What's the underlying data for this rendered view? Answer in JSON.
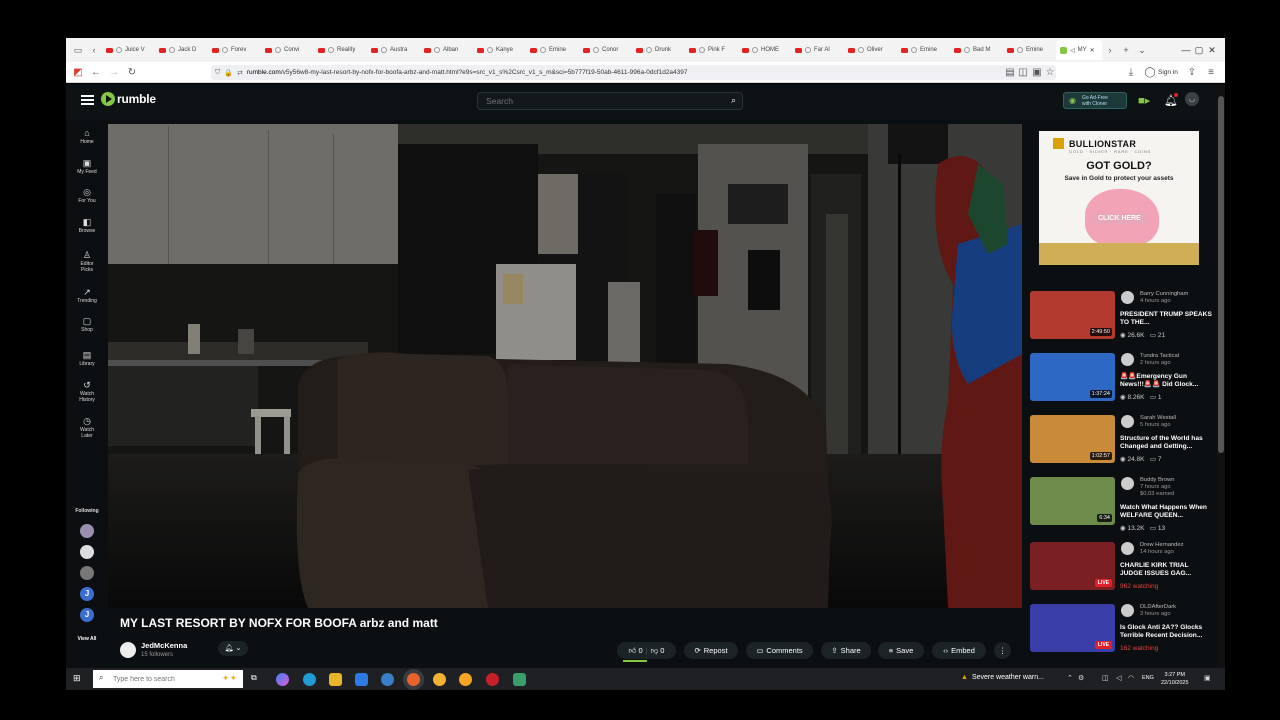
{
  "browser": {
    "tabs": [
      {
        "label": "Juice V"
      },
      {
        "label": "Jack D"
      },
      {
        "label": "Forev"
      },
      {
        "label": "Convi"
      },
      {
        "label": "Reality"
      },
      {
        "label": "Austra"
      },
      {
        "label": "Alban"
      },
      {
        "label": "Kanye"
      },
      {
        "label": "Emine"
      },
      {
        "label": "Conor"
      },
      {
        "label": "Drunk"
      },
      {
        "label": "Pink F"
      },
      {
        "label": "HOME"
      },
      {
        "label": "Far Al"
      },
      {
        "label": "Oliver"
      },
      {
        "label": "Emine"
      },
      {
        "label": "Bad M"
      },
      {
        "label": "Emine"
      }
    ],
    "active_tab": "MY",
    "url_domain": "rumble.com",
    "url_path": "/v5y56w8-my-last-resort-by-nofx-for-boofa-arbz-and-matt.html?e9s=src_v1_s%2Csrc_v1_s_m&sci=5b777f19-50ab-4611-996a-0dcf1d2a4397",
    "signin_label": "Sign in"
  },
  "header": {
    "logo_text": "rumble",
    "search_placeholder": "Search",
    "adfree_line1": "Go Ad-Free",
    "adfree_line2": "with Cloner"
  },
  "sidebar": {
    "items": [
      {
        "icon": "⌂",
        "label": "Home"
      },
      {
        "icon": "▣",
        "label": "My Feed"
      },
      {
        "icon": "◎",
        "label": "For You"
      },
      {
        "icon": "◧",
        "label": "Browse"
      },
      {
        "icon": "♙",
        "label": "Editor"
      },
      {
        "icon": "↗",
        "label": "Trending"
      },
      {
        "icon": "▢",
        "label": "Shop"
      },
      {
        "icon": "▤",
        "label": "Library"
      },
      {
        "icon": "↺",
        "label": "Watch"
      },
      {
        "icon": "◷",
        "label": "Watch"
      }
    ],
    "item_sublabels": [
      "",
      "",
      "",
      "",
      "Picks",
      "",
      "",
      "",
      "History",
      "Later"
    ],
    "following_label": "Following",
    "subs": [
      "",
      "",
      "",
      "J",
      "J"
    ],
    "view_all_label": "View All"
  },
  "video": {
    "title": "MY LAST RESORT BY NOFX FOR BOOFA arbz and matt",
    "channel_name": "JedMcKenna",
    "followers": "15 followers",
    "likes": "0",
    "dislikes": "0",
    "repost_label": "Repost",
    "comments_label": "Comments",
    "share_label": "Share",
    "save_label": "Save",
    "embed_label": "Embed",
    "more_label": "⋮"
  },
  "ad": {
    "brand": "BULLIONSTAR",
    "tagline": "GOLD · SILVER · RARE · COINS",
    "headline": "GOT GOLD?",
    "subline": "Save in Gold to protect your assets",
    "cta": "CLICK HERE"
  },
  "recommended": [
    {
      "channel": "Barry Cunningham",
      "ago": "4 hours ago",
      "earned": "",
      "title": "PRESIDENT TRUMP SPEAKS TO THE...",
      "views": "26.6K",
      "comments": "21",
      "duration": "2:49:50",
      "live": false,
      "watching": "",
      "thumb_color": "#b23a2e"
    },
    {
      "channel": "Tundra Tactical",
      "ago": "2 hours ago",
      "earned": "",
      "title": "🚨🚨Emergency Gun News!!!🚨🚨 Did Glock...",
      "views": "8.26K",
      "comments": "1",
      "duration": "1:37:24",
      "live": false,
      "watching": "",
      "thumb_color": "#2d69c4"
    },
    {
      "channel": "Sarah Westall",
      "ago": "5 hours ago",
      "earned": "",
      "title": "Structure of the World has Changed and Getting...",
      "views": "24.8K",
      "comments": "7",
      "duration": "1:02:57",
      "live": false,
      "watching": "",
      "thumb_color": "#c98a3a"
    },
    {
      "channel": "Buddy Brown",
      "ago": "7 hours ago",
      "earned": "$0.03 earned",
      "title": "Watch What Happens When WELFARE QUEEN...",
      "views": "13.2K",
      "comments": "13",
      "duration": "6:34",
      "live": false,
      "watching": "",
      "thumb_color": "#6f8b4a"
    },
    {
      "channel": "Drew Hernandez",
      "ago": "14 hours ago",
      "earned": "",
      "title": "CHARLIE KIRK TRIAL JUDGE ISSUES GAG...",
      "views": "",
      "comments": "",
      "duration": "LIVE",
      "live": true,
      "watching": "962 watching",
      "thumb_color": "#7a1f22"
    },
    {
      "channel": "DLDAfterDark",
      "ago": "3 hours ago",
      "earned": "",
      "title": "Is Glock Anti 2A?? Glocks Terrible Recent Decision...",
      "views": "",
      "comments": "",
      "duration": "LIVE",
      "live": true,
      "watching": "162 watching",
      "thumb_color": "#3a3ea8"
    }
  ],
  "taskbar": {
    "search_placeholder": "Type here to search",
    "weather": "Severe weather warn...",
    "lang": "ENG",
    "time": "3:27 PM",
    "date": "22/10/2025"
  }
}
